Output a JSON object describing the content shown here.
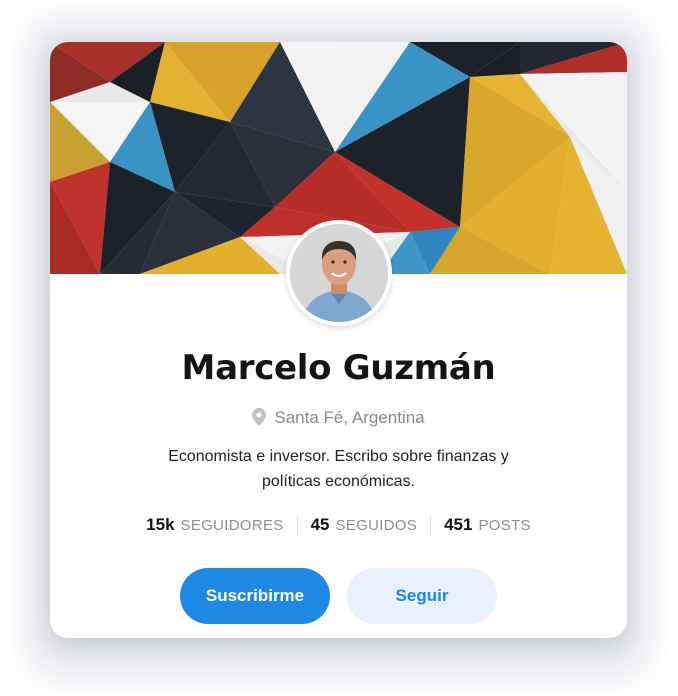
{
  "profile": {
    "name": "Marcelo Guzmán",
    "location": "Santa Fé, Argentina",
    "bio": "Economista e inversor. Escribo sobre finanzas y políticas económicas."
  },
  "stats": [
    {
      "value": "15k",
      "label": "SEGUIDORES"
    },
    {
      "value": "45",
      "label": "SEGUIDOS"
    },
    {
      "value": "451",
      "label": "POSTS"
    }
  ],
  "actions": {
    "subscribe_label": "Suscribirme",
    "follow_label": "Seguir"
  },
  "icons": {
    "location": "map-pin-icon"
  },
  "colors": {
    "accent": "#1e88e5",
    "accent_soft": "#e8f1fd",
    "text": "#141414",
    "muted": "#8a8a8a"
  }
}
